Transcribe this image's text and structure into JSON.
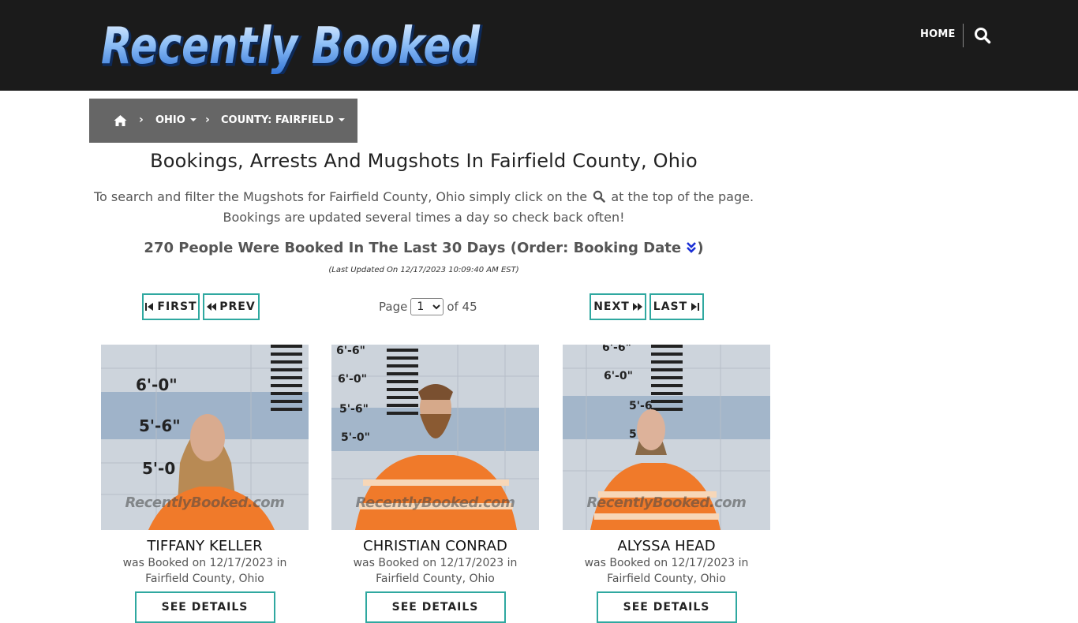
{
  "header": {
    "logo_text": "Recently Booked",
    "nav": {
      "home_label": "HOME"
    }
  },
  "breadcrumb": {
    "state_label": "OHIO",
    "county_label": "COUNTY: FAIRFIELD"
  },
  "main": {
    "title": "Bookings, Arrests And Mugshots In Fairfield County, Ohio",
    "intro_before": "To search and filter the Mugshots for Fairfield County, Ohio simply click on the",
    "intro_after": "at the top of the page. Bookings are updated several times a day so check back often!",
    "count_text": "270 People Were Booked In The Last 30 Days (Order: Booking Date",
    "count_close": ")",
    "last_updated": "(Last Updated On 12/17/2023 10:09:40 AM EST)"
  },
  "pager": {
    "first_label": "FIRST",
    "prev_label": "PREV",
    "next_label": "NEXT",
    "last_label": "LAST",
    "page_word": "Page",
    "current_page": "1",
    "of_text": "of 45"
  },
  "cards": [
    {
      "name": "TIFFANY KELLER",
      "booked_line1": "was Booked on 12/17/2023 in",
      "booked_line2": "Fairfield County, Ohio",
      "watermark": "RecentlyBooked.com",
      "details_label": "SEE DETAILS"
    },
    {
      "name": "CHRISTIAN CONRAD",
      "booked_line1": "was Booked on 12/17/2023 in",
      "booked_line2": "Fairfield County, Ohio",
      "watermark": "RecentlyBooked.com",
      "details_label": "SEE DETAILS"
    },
    {
      "name": "ALYSSA HEAD",
      "booked_line1": "was Booked on 12/17/2023 in",
      "booked_line2": "Fairfield County, Ohio",
      "watermark": "RecentlyBooked.com",
      "details_label": "SEE DETAILS"
    }
  ],
  "colors": {
    "header_bg": "#1b1b1b",
    "breadcrumb_bg": "#666666",
    "button_border": "#2fa8a0",
    "logo_blue": "#6aa8f0",
    "order_icon": "#1a2fd6",
    "jumpsuit_orange": "#f07a2a"
  },
  "icons": {
    "search": "search-icon",
    "home": "home-icon",
    "first": "step-backward-icon",
    "prev": "backward-icon",
    "next": "forward-icon",
    "last": "step-forward-icon",
    "order": "double-chevron-down-icon"
  }
}
